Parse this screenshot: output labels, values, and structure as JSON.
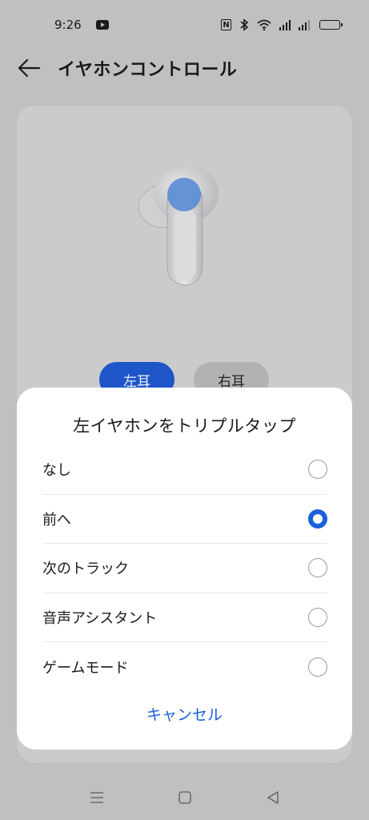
{
  "status_bar": {
    "time": "9:26",
    "icons": [
      "youtube-icon",
      "nfc-icon",
      "bluetooth-icon",
      "wifi-icon",
      "signal-icon",
      "battery-icon"
    ]
  },
  "header": {
    "back_icon": "arrow-left-icon",
    "title": "イヤホンコントロール"
  },
  "card": {
    "tabs": [
      {
        "label": "左耳",
        "active": true
      },
      {
        "label": "右耳",
        "active": false
      }
    ]
  },
  "dialog": {
    "title": "左イヤホンをトリプルタップ",
    "options": [
      {
        "label": "なし",
        "selected": false
      },
      {
        "label": "前へ",
        "selected": true
      },
      {
        "label": "次のトラック",
        "selected": false
      },
      {
        "label": "音声アシスタント",
        "selected": false
      },
      {
        "label": "ゲームモード",
        "selected": false
      }
    ],
    "cancel_label": "キャンセル"
  },
  "navbar": {
    "icons": [
      "menu-icon",
      "home-icon",
      "back-triangle-icon"
    ]
  },
  "colors": {
    "accent": "#1a5fdb",
    "tab_active": "#1e56c9",
    "scrim": "#bfc0c2"
  }
}
